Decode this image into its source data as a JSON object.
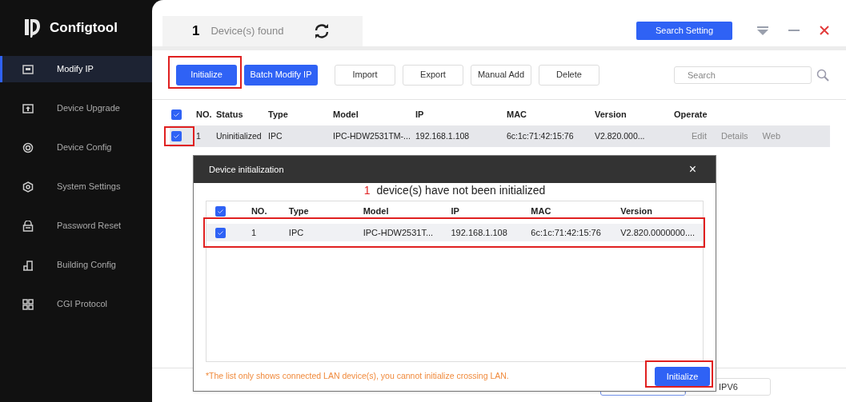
{
  "app": {
    "name": "Configtool"
  },
  "sidebar": {
    "items": [
      {
        "label": "Modify IP",
        "selected": true
      },
      {
        "label": "Device Upgrade",
        "selected": false
      },
      {
        "label": "Device Config",
        "selected": false
      },
      {
        "label": "System Settings",
        "selected": false
      },
      {
        "label": "Password Reset",
        "selected": false
      },
      {
        "label": "Building Config",
        "selected": false
      },
      {
        "label": "CGI Protocol",
        "selected": false
      }
    ]
  },
  "header": {
    "count": "1",
    "label": "Device(s) found",
    "search_setting": "Search Setting"
  },
  "toolbar": {
    "buttons": [
      {
        "label": "Initialize",
        "kind": "primary",
        "highlighted": true
      },
      {
        "label": "Batch Modify IP",
        "kind": "primary",
        "highlighted": false
      },
      {
        "label": "Import",
        "kind": "default",
        "highlighted": false
      },
      {
        "label": "Export",
        "kind": "default",
        "highlighted": false
      },
      {
        "label": "Manual Add",
        "kind": "default",
        "highlighted": false
      },
      {
        "label": "Delete",
        "kind": "default",
        "highlighted": false
      }
    ],
    "search": {
      "placeholder": "Search"
    }
  },
  "table": {
    "header_checked": true,
    "columns": [
      "NO.",
      "Status",
      "Type",
      "Model",
      "IP",
      "MAC",
      "Version",
      "Operate"
    ],
    "rows": [
      {
        "checked": true,
        "highlighted": true,
        "cells": [
          "1",
          "Uninitialized",
          "IPC",
          "IPC-HDW2531TM-...",
          "192.168.1.108",
          "6c:1c:71:42:15:76",
          "V2.820.000..."
        ],
        "actions": [
          "Edit",
          "Details",
          "Web"
        ]
      }
    ]
  },
  "bottom": {
    "field_value": "IPV6"
  },
  "dialog": {
    "title": "Device initialization",
    "close": "×",
    "summary_count": "1",
    "summary": "device(s) have not been initialized",
    "header_checked": true,
    "columns": [
      "NO.",
      "Type",
      "Model",
      "IP",
      "MAC",
      "Version"
    ],
    "rows": [
      {
        "checked": true,
        "highlighted": true,
        "cells": [
          "1",
          "IPC",
          "IPC-HDW2531T...",
          "192.168.1.108",
          "6c:1c:71:42:15:76",
          "V2.820.0000000...."
        ]
      }
    ],
    "note": "*The list only shows connected LAN device(s), you cannot initialize crossing LAN.",
    "button": {
      "label": "Initialize",
      "highlighted": true
    }
  }
}
